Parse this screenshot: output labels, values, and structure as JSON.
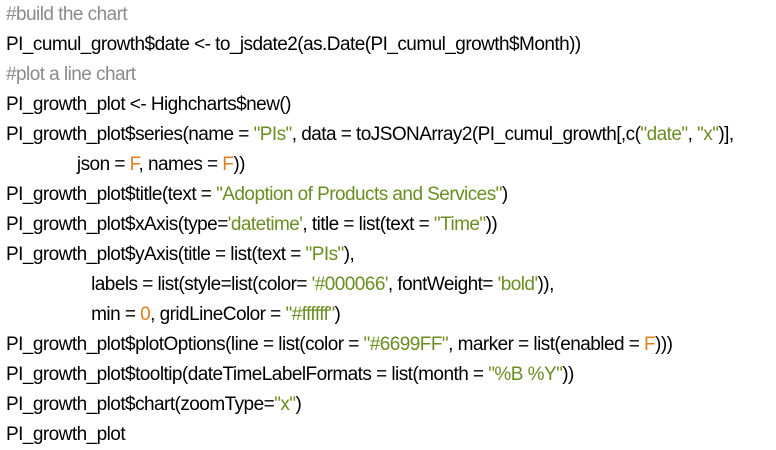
{
  "code_lines": [
    [
      {
        "t": "c",
        "v": "#build the chart"
      }
    ],
    [
      {
        "t": "t",
        "v": "PI_cumul_growth$date <- to_jsdate2(as.Date(PI_cumul_growth$Month))"
      }
    ],
    [
      {
        "t": "c",
        "v": "#plot a line chart"
      }
    ],
    [
      {
        "t": "t",
        "v": "PI_growth_plot <- Highcharts$new()"
      }
    ],
    [
      {
        "t": "t",
        "v": "PI_growth_plot$series(name = "
      },
      {
        "t": "s",
        "v": "\"PIs\""
      },
      {
        "t": "t",
        "v": ", data = toJSONArray2(PI_cumul_growth[,c("
      },
      {
        "t": "s",
        "v": "\"date\""
      },
      {
        "t": "t",
        "v": ", "
      },
      {
        "t": "s",
        "v": "\"x\""
      },
      {
        "t": "t",
        "v": ")],"
      }
    ],
    [
      {
        "t": "t",
        "v": "               json = "
      },
      {
        "t": "k",
        "v": "F"
      },
      {
        "t": "t",
        "v": ", names = "
      },
      {
        "t": "k",
        "v": "F"
      },
      {
        "t": "t",
        "v": "))"
      }
    ],
    [
      {
        "t": "t",
        "v": "PI_growth_plot$title(text = "
      },
      {
        "t": "s",
        "v": "\"Adoption of Products and Services\""
      },
      {
        "t": "t",
        "v": ")"
      }
    ],
    [
      {
        "t": "t",
        "v": "PI_growth_plot$xAxis(type="
      },
      {
        "t": "s",
        "v": "'datetime'"
      },
      {
        "t": "t",
        "v": ", title = list(text = "
      },
      {
        "t": "s",
        "v": "\"Time\""
      },
      {
        "t": "t",
        "v": "))"
      }
    ],
    [
      {
        "t": "t",
        "v": "PI_growth_plot$yAxis(title = list(text = "
      },
      {
        "t": "s",
        "v": "\"PIs\""
      },
      {
        "t": "t",
        "v": "),"
      }
    ],
    [
      {
        "t": "t",
        "v": "                  labels = list(style=list(color= "
      },
      {
        "t": "s",
        "v": "'#000066'"
      },
      {
        "t": "t",
        "v": ", fontWeight= "
      },
      {
        "t": "s",
        "v": "'bold'"
      },
      {
        "t": "t",
        "v": ")),"
      }
    ],
    [
      {
        "t": "t",
        "v": "                  min = "
      },
      {
        "t": "n",
        "v": "0"
      },
      {
        "t": "t",
        "v": ", gridLineColor = "
      },
      {
        "t": "s",
        "v": "\"#ffffff\""
      },
      {
        "t": "t",
        "v": ")"
      }
    ],
    [
      {
        "t": "t",
        "v": "PI_growth_plot$plotOptions(line = list(color = "
      },
      {
        "t": "s",
        "v": "\"#6699FF\""
      },
      {
        "t": "t",
        "v": ", marker = list(enabled = "
      },
      {
        "t": "k",
        "v": "F"
      },
      {
        "t": "t",
        "v": ")))"
      }
    ],
    [
      {
        "t": "t",
        "v": "PI_growth_plot$tooltip(dateTimeLabelFormats = list(month = "
      },
      {
        "t": "s",
        "v": "\"%B %Y\""
      },
      {
        "t": "t",
        "v": "))"
      }
    ],
    [
      {
        "t": "t",
        "v": "PI_growth_plot$chart(zoomType="
      },
      {
        "t": "s",
        "v": "\"x\""
      },
      {
        "t": "t",
        "v": ")"
      }
    ],
    [
      {
        "t": "t",
        "v": "PI_growth_plot"
      }
    ]
  ],
  "colors": {
    "background": "#ffffff",
    "text": "#000000",
    "comment": "#8a8a8a",
    "string": "#6b8e23",
    "constant": "#e08020"
  }
}
